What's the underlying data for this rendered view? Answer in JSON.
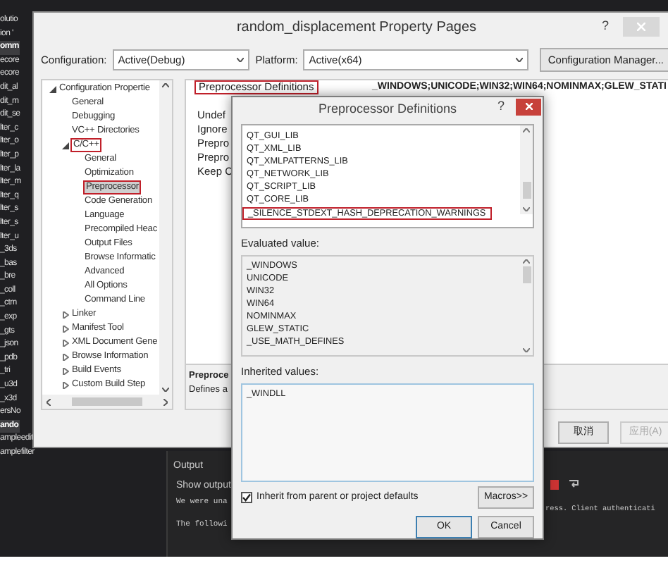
{
  "solution_explorer": {
    "items": [
      {
        "text": "olutio",
        "selected": false
      },
      {
        "text": "ion '",
        "selected": false
      },
      {
        "text": "omm",
        "selected": true
      },
      {
        "text": "ecore",
        "selected": false
      },
      {
        "text": "ecore",
        "selected": false
      },
      {
        "text": "dit_al",
        "selected": false
      },
      {
        "text": "dit_m",
        "selected": false
      },
      {
        "text": "dit_se",
        "selected": false
      },
      {
        "text": "lter_c",
        "selected": false
      },
      {
        "text": "lter_o",
        "selected": false
      },
      {
        "text": "lter_p",
        "selected": false
      },
      {
        "text": "lter_la",
        "selected": false
      },
      {
        "text": "lter_m",
        "selected": false
      },
      {
        "text": "lter_q",
        "selected": false
      },
      {
        "text": "lter_s",
        "selected": false
      },
      {
        "text": "lter_s",
        "selected": false
      },
      {
        "text": "lter_u",
        "selected": false
      },
      {
        "text": "_3ds",
        "selected": false
      },
      {
        "text": "_bas",
        "selected": false
      },
      {
        "text": "_bre",
        "selected": false
      },
      {
        "text": "_coll",
        "selected": false
      },
      {
        "text": "_ctm",
        "selected": false
      },
      {
        "text": "_exp",
        "selected": false
      },
      {
        "text": "_gts",
        "selected": false
      },
      {
        "text": "_json",
        "selected": false
      },
      {
        "text": "_pdb",
        "selected": false
      },
      {
        "text": "_tri",
        "selected": false
      },
      {
        "text": "_u3d",
        "selected": false
      },
      {
        "text": "_x3d",
        "selected": false
      },
      {
        "text": "ersNo",
        "selected": false
      },
      {
        "text": "ando",
        "selected": true
      },
      {
        "text": "ampleedit",
        "selected": false
      },
      {
        "text": "amplefilter",
        "selected": false
      }
    ]
  },
  "output_panel": {
    "title": "Output",
    "show_output_label": "Show output",
    "lines": [
      "We were una",
      "The followi"
    ],
    "right_text": "ress. Client authenticati"
  },
  "property_pages": {
    "title": "random_displacement Property Pages",
    "help": "?",
    "configuration_label": "Configuration:",
    "configuration_value": "Active(Debug)",
    "platform_label": "Platform:",
    "platform_value": "Active(x64)",
    "configuration_manager": "Configuration Manager...",
    "tree": [
      {
        "label": "Configuration Propertie",
        "expanded": true,
        "selected": false,
        "annotated": false,
        "children": [
          {
            "label": "General",
            "selected": false,
            "annotated": false
          },
          {
            "label": "Debugging",
            "selected": false,
            "annotated": false
          },
          {
            "label": "VC++ Directories",
            "selected": false,
            "annotated": false
          },
          {
            "label": "C/C++",
            "expanded": true,
            "selected": false,
            "annotated": true,
            "children": [
              {
                "label": "General",
                "selected": false,
                "annotated": false
              },
              {
                "label": "Optimization",
                "selected": false,
                "annotated": false
              },
              {
                "label": "Preprocessor",
                "selected": true,
                "annotated": true
              },
              {
                "label": "Code Generation",
                "selected": false,
                "annotated": false
              },
              {
                "label": "Language",
                "selected": false,
                "annotated": false
              },
              {
                "label": "Precompiled Heac",
                "selected": false,
                "annotated": false
              },
              {
                "label": "Output Files",
                "selected": false,
                "annotated": false
              },
              {
                "label": "Browse Informatic",
                "selected": false,
                "annotated": false
              },
              {
                "label": "Advanced",
                "selected": false,
                "annotated": false
              },
              {
                "label": "All Options",
                "selected": false,
                "annotated": false
              },
              {
                "label": "Command Line",
                "selected": false,
                "annotated": false
              }
            ]
          },
          {
            "label": "Linker",
            "expanded": false,
            "selected": false,
            "annotated": false
          },
          {
            "label": "Manifest Tool",
            "expanded": false,
            "selected": false,
            "annotated": false
          },
          {
            "label": "XML Document Gene",
            "expanded": false,
            "selected": false,
            "annotated": false
          },
          {
            "label": "Browse Information",
            "expanded": false,
            "selected": false,
            "annotated": false
          },
          {
            "label": "Build Events",
            "expanded": false,
            "selected": false,
            "annotated": false
          },
          {
            "label": "Custom Build Step",
            "expanded": false,
            "selected": false,
            "annotated": false
          }
        ]
      }
    ],
    "properties": [
      {
        "name": "Preprocessor Definitions",
        "value": "_WINDOWS;UNICODE;WIN32;WIN64;NOMINMAX;GLEW_STATI",
        "annotated": true
      },
      {
        "name": "Undef",
        "annotated": false
      },
      {
        "name": "Ignore",
        "annotated": false
      },
      {
        "name": "Prepro",
        "annotated": false
      },
      {
        "name": "Prepro",
        "annotated": false
      },
      {
        "name": "Keep C",
        "annotated": false
      }
    ],
    "description": {
      "title": "Preproce",
      "text": "Defines a"
    },
    "buttons": [
      {
        "label": "取消",
        "disabled": false
      },
      {
        "label": "应用(A)",
        "disabled": true
      }
    ]
  },
  "definitions_dialog": {
    "title": "Preprocessor Definitions",
    "help": "?",
    "definitions": [
      {
        "text": "QT_GUI_LIB",
        "annotated": false
      },
      {
        "text": "QT_XML_LIB",
        "annotated": false
      },
      {
        "text": "QT_XMLPATTERNS_LIB",
        "annotated": false
      },
      {
        "text": "QT_NETWORK_LIB",
        "annotated": false
      },
      {
        "text": "QT_SCRIPT_LIB",
        "annotated": false
      },
      {
        "text": "QT_CORE_LIB",
        "annotated": false
      },
      {
        "text": "_SILENCE_STDEXT_HASH_DEPRECATION_WARNINGS",
        "annotated": true
      }
    ],
    "evaluated_label": "Evaluated value:",
    "evaluated": [
      "_WINDOWS",
      "UNICODE",
      "WIN32",
      "WIN64",
      "NOMINMAX",
      "GLEW_STATIC",
      "_USE_MATH_DEFINES"
    ],
    "inherited_label": "Inherited values:",
    "inherited": [
      "_WINDLL"
    ],
    "inherit_checkbox": {
      "label": "Inherit from parent or project defaults",
      "checked": true
    },
    "macros_button": "Macros>>",
    "ok_button": "OK",
    "cancel_button": "Cancel"
  }
}
